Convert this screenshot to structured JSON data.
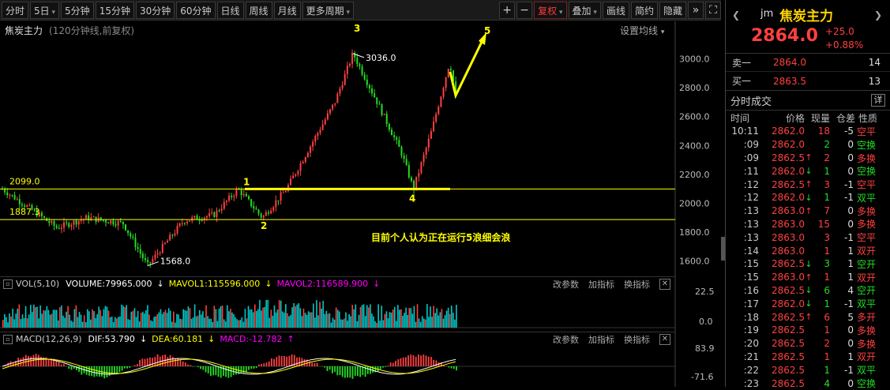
{
  "toolbar": {
    "periods": [
      "分时",
      "5日",
      "5分钟",
      "15分钟",
      "30分钟",
      "60分钟",
      "日线",
      "周线",
      "月线",
      "更多周期"
    ],
    "plus": "+",
    "minus": "−",
    "restore": "复权",
    "overlay": "叠加",
    "draw": "画线",
    "brief": "简约",
    "hide": "隐藏"
  },
  "chart": {
    "title": "焦炭主力",
    "subtitle": "(120分钟线,前复权)",
    "ma_settings": "设置均线",
    "annotation": "目前个人认为正在运行5浪细会浪",
    "level_high_label": "2099.0",
    "level_low_label": "1887.3",
    "peak_label": "3036.0",
    "trough_label": "1568.0",
    "wave_labels": [
      "1",
      "2",
      "3",
      "4",
      "5"
    ]
  },
  "chart_data": [
    {
      "type": "candlestick",
      "title": "焦炭主力",
      "ylim": [
        1500,
        3150
      ],
      "yticks": [
        1600.0,
        1800.0,
        2000.0,
        2200.0,
        2400.0,
        2600.0,
        2800.0,
        3000.0
      ],
      "anchors": [
        [
          0,
          2099
        ],
        [
          0.05,
          1950
        ],
        [
          0.09,
          1830
        ],
        [
          0.14,
          1900
        ],
        [
          0.2,
          1860
        ],
        [
          0.24,
          1568
        ],
        [
          0.3,
          1880
        ],
        [
          0.35,
          1920
        ],
        [
          0.39,
          2099
        ],
        [
          0.43,
          1900
        ],
        [
          0.47,
          2100
        ],
        [
          0.51,
          2400
        ],
        [
          0.55,
          2700
        ],
        [
          0.58,
          3036
        ],
        [
          0.62,
          2700
        ],
        [
          0.66,
          2350
        ],
        [
          0.68,
          2100
        ],
        [
          0.71,
          2500
        ],
        [
          0.74,
          2980
        ],
        [
          0.75,
          2750
        ]
      ],
      "levels": [
        2099.0,
        1887.3
      ],
      "marks": {
        "high": 3036.0,
        "low": 1568.0
      }
    },
    {
      "type": "bar",
      "title": "VOL(5,10)",
      "series": [
        {
          "name": "VOLUME",
          "value": 79965.0
        },
        {
          "name": "MAVOL1",
          "value": 115596.0
        },
        {
          "name": "MAVOL2",
          "value": 116589.9
        }
      ],
      "yticks": [
        "22.5",
        "0.0"
      ]
    },
    {
      "type": "line",
      "title": "MACD(12,26,9)",
      "series": [
        {
          "name": "DIF",
          "value": 53.79
        },
        {
          "name": "DEA",
          "value": 60.181
        },
        {
          "name": "MACD",
          "value": -12.782
        }
      ],
      "yticks": [
        "83.9",
        "-71.6"
      ]
    }
  ],
  "vol_bar": {
    "label": "VOL(5,10)",
    "volume": "VOLUME:79965.000",
    "mavol1": "MAVOL1:115596.000",
    "mavol2": "MAVOL2:116589.900",
    "ctrl_params": "改参数",
    "ctrl_add": "加指标",
    "ctrl_swap": "换指标"
  },
  "macd_bar": {
    "label": "MACD(12,26,9)",
    "dif": "DIF:53.790",
    "dea": "DEA:60.181",
    "macd": "MACD:-12.782",
    "ctrl_params": "改参数",
    "ctrl_add": "加指标",
    "ctrl_swap": "换指标"
  },
  "quote": {
    "code": "jm",
    "name": "焦炭主力",
    "price": "2864.0",
    "change": "+25.0",
    "change_pct": "+0.88%",
    "sell_label": "卖一",
    "sell_price": "2864.0",
    "sell_vol": "14",
    "buy_label": "买一",
    "buy_price": "2863.5",
    "buy_vol": "13"
  },
  "ticks": {
    "title": "分时成交",
    "detail": "详",
    "cols": [
      "时间",
      "价格",
      "现量",
      "仓差",
      "性质"
    ],
    "rows": [
      {
        "time": "10:11",
        "price": "2862.0",
        "arrow": "",
        "vol": "18",
        "oi": "-5",
        "type": "空平",
        "tc": "#ff4040",
        "vc": "#ff4040"
      },
      {
        "time": ":09",
        "price": "2862.0",
        "arrow": "",
        "vol": "2",
        "oi": "0",
        "type": "空换",
        "tc": "#22dd22",
        "vc": "#22dd22"
      },
      {
        "time": ":09",
        "price": "2862.5",
        "arrow": "↑",
        "vol": "2",
        "oi": "0",
        "type": "多换",
        "tc": "#ff4040",
        "vc": "#ff4040"
      },
      {
        "time": ":11",
        "price": "2862.0",
        "arrow": "↓",
        "vol": "1",
        "oi": "0",
        "type": "空换",
        "tc": "#22dd22",
        "vc": "#22dd22"
      },
      {
        "time": ":12",
        "price": "2862.5",
        "arrow": "↑",
        "vol": "3",
        "oi": "-1",
        "type": "空平",
        "tc": "#ff4040",
        "vc": "#ff4040"
      },
      {
        "time": ":12",
        "price": "2862.0",
        "arrow": "↓",
        "vol": "1",
        "oi": "-1",
        "type": "双平",
        "tc": "#22dd22",
        "vc": "#22dd22"
      },
      {
        "time": ":13",
        "price": "2863.0",
        "arrow": "↑",
        "vol": "7",
        "oi": "0",
        "type": "多换",
        "tc": "#ff4040",
        "vc": "#ff4040"
      },
      {
        "time": ":13",
        "price": "2863.0",
        "arrow": "",
        "vol": "15",
        "oi": "0",
        "type": "多换",
        "tc": "#ff4040",
        "vc": "#ff4040"
      },
      {
        "time": ":13",
        "price": "2863.0",
        "arrow": "",
        "vol": "3",
        "oi": "-1",
        "type": "空平",
        "tc": "#ff4040",
        "vc": "#ff4040"
      },
      {
        "time": ":14",
        "price": "2863.0",
        "arrow": "",
        "vol": "1",
        "oi": "1",
        "type": "双开",
        "tc": "#ff4040",
        "vc": "#ff4040"
      },
      {
        "time": ":15",
        "price": "2862.5",
        "arrow": "↓",
        "vol": "3",
        "oi": "1",
        "type": "空开",
        "tc": "#22dd22",
        "vc": "#22dd22"
      },
      {
        "time": ":15",
        "price": "2863.0",
        "arrow": "↑",
        "vol": "1",
        "oi": "1",
        "type": "双开",
        "tc": "#ff4040",
        "vc": "#ff4040"
      },
      {
        "time": ":16",
        "price": "2862.5",
        "arrow": "↓",
        "vol": "6",
        "oi": "4",
        "type": "空开",
        "tc": "#22dd22",
        "vc": "#22dd22"
      },
      {
        "time": ":17",
        "price": "2862.0",
        "arrow": "↓",
        "vol": "1",
        "oi": "-1",
        "type": "双平",
        "tc": "#22dd22",
        "vc": "#22dd22"
      },
      {
        "time": ":18",
        "price": "2862.5",
        "arrow": "↑",
        "vol": "6",
        "oi": "5",
        "type": "多开",
        "tc": "#ff4040",
        "vc": "#ff4040"
      },
      {
        "time": ":19",
        "price": "2862.5",
        "arrow": "",
        "vol": "1",
        "oi": "0",
        "type": "多换",
        "tc": "#ff4040",
        "vc": "#ff4040"
      },
      {
        "time": ":20",
        "price": "2862.5",
        "arrow": "",
        "vol": "2",
        "oi": "0",
        "type": "多换",
        "tc": "#ff4040",
        "vc": "#ff4040"
      },
      {
        "time": ":21",
        "price": "2862.5",
        "arrow": "",
        "vol": "1",
        "oi": "1",
        "type": "双开",
        "tc": "#ff4040",
        "vc": "#ff4040"
      },
      {
        "time": ":22",
        "price": "2862.5",
        "arrow": "",
        "vol": "1",
        "oi": "-1",
        "type": "双平",
        "tc": "#22dd22",
        "vc": "#22dd22"
      },
      {
        "time": ":23",
        "price": "2862.5",
        "arrow": "",
        "vol": "4",
        "oi": "0",
        "type": "空换",
        "tc": "#22dd22",
        "vc": "#22dd22"
      }
    ]
  },
  "colors": {
    "up": "#ff4040",
    "down": "#22dd22",
    "accent": "#ffff00",
    "macd_dif": "#ffffff",
    "macd_dea": "#ffff00",
    "macd_bar": "#ff00ff",
    "vol": "#00c8c8"
  }
}
